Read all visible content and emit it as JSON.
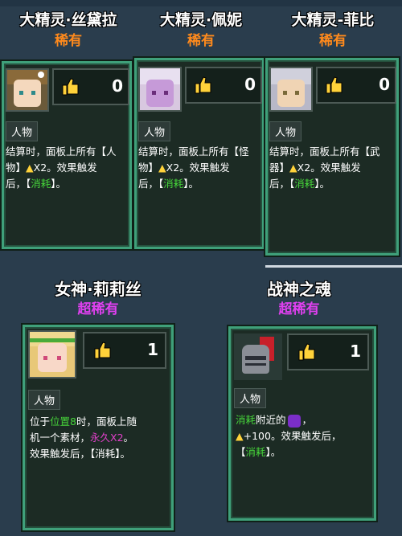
{
  "cards": [
    {
      "title": "大精灵·丝黛拉",
      "rarity": "稀有",
      "likes": "0",
      "tag": "人物",
      "desc_1": "结算时，面板上所有【人",
      "desc_2a": "物】",
      "desc_2b": "X2。效果触发",
      "desc_3a": "后，【",
      "desc_3b": "消耗",
      "desc_3c": "】。"
    },
    {
      "title": "大精灵·佩妮",
      "rarity": "稀有",
      "likes": "0",
      "tag": "人物",
      "desc_1": "结算时，面板上所有【怪",
      "desc_2a": "物】",
      "desc_2b": "X2。效果触发",
      "desc_3a": "后，【",
      "desc_3b": "消耗",
      "desc_3c": "】。"
    },
    {
      "title": "大精灵-菲比",
      "rarity": "稀有",
      "likes": "0",
      "tag": "人物",
      "desc_1": "结算时，面板上所有【武",
      "desc_2a": "器】",
      "desc_2b": "X2。效果触发",
      "desc_3a": "后，【",
      "desc_3b": "消耗",
      "desc_3c": "】。"
    },
    {
      "title": "女神·莉莉丝",
      "rarity": "超稀有",
      "likes": "1",
      "tag": "人物",
      "desc_1a": "位于",
      "desc_1b": "位置8",
      "desc_1c": "时，面板上随",
      "desc_2a": "机一个素材，",
      "desc_2b": "永久X2",
      "desc_2c": "。",
      "desc_3": "效果触发后，【消耗】。"
    },
    {
      "title": "战神之魂",
      "rarity": "超稀有",
      "likes": "1",
      "tag": "人物",
      "desc_1a": "消耗",
      "desc_1b": "附近的",
      "desc_1c": "，",
      "desc_2": "+100。效果触发后，",
      "desc_3a": "【",
      "desc_3b": "消耗",
      "desc_3c": "】。"
    }
  ],
  "colors": {
    "rare": "#ff8a1c",
    "super_rare": "#e040f0",
    "card_border": "#3fa07a"
  }
}
